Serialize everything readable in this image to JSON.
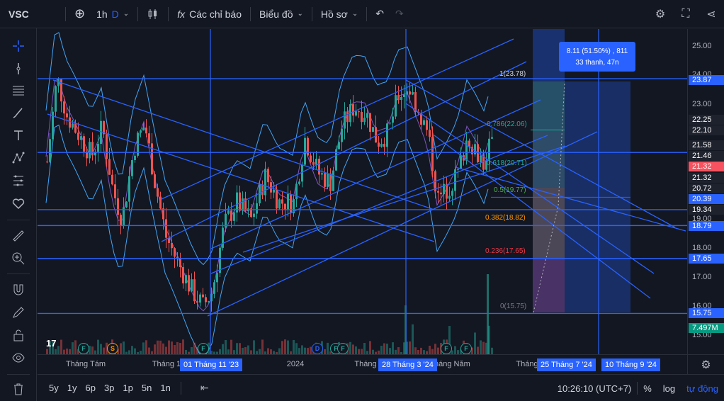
{
  "toolbar": {
    "symbol": "VSC",
    "interval": "1h",
    "interval_type": "D",
    "indicators_label": "Các chỉ báo",
    "chart_type_label": "Biểu đồ",
    "profile_label": "Hồ sơ"
  },
  "chart": {
    "measure_line1": "8.11 (51.50%) , 811",
    "measure_line2": "33 thanh, 47n",
    "fib_levels": [
      {
        "label": "1(23.78)",
        "color": "#787b86"
      },
      {
        "label": "0.786(22.06)",
        "color": "#26a69a"
      },
      {
        "label": "0.618(20.71)",
        "color": "#26a69a"
      },
      {
        "label": "0.5(19.77)",
        "color": "#4caf50"
      },
      {
        "label": "0.382(18.82)",
        "color": "#ff9800"
      },
      {
        "label": "0.236(17.65)",
        "color": "#f23645"
      },
      {
        "label": "0(15.75)",
        "color": "#787b86"
      }
    ],
    "event_badges": [
      "F",
      "S",
      "F",
      "D",
      "F",
      "F",
      "F",
      "F"
    ],
    "tv_logo": "17"
  },
  "price_axis": {
    "ticks": [
      "25.00",
      "24.00",
      "23.00",
      "19.00",
      "18.00",
      "17.00",
      "16.00",
      "15.00"
    ],
    "tags": [
      {
        "value": "23.87",
        "bg": "#2962ff"
      },
      {
        "value": "22.25",
        "bg": "#1e222d"
      },
      {
        "value": "22.10",
        "bg": "#1e222d"
      },
      {
        "value": "21.58",
        "bg": "#1e222d"
      },
      {
        "value": "21.46",
        "bg": "#1e222d"
      },
      {
        "value": "21.32",
        "bg": "#f7525f"
      },
      {
        "value": "21.32",
        "bg": "#1e222d"
      },
      {
        "value": "20.72",
        "bg": "#1e222d"
      },
      {
        "value": "20.39",
        "bg": "#2962ff"
      },
      {
        "value": "19.34",
        "bg": "#1e222d"
      },
      {
        "value": "18.79",
        "bg": "#2962ff"
      },
      {
        "value": "17.65",
        "bg": "#2962ff"
      },
      {
        "value": "15.75",
        "bg": "#2962ff"
      },
      {
        "value": "7.497M",
        "bg": "#089981"
      }
    ]
  },
  "time_axis": {
    "ticks": [
      "Tháng Tám",
      "Tháng 1",
      "2024",
      "Tháng",
      "Tháng Năm",
      "Tháng"
    ],
    "tags": [
      "01 Tháng 11 '23",
      "28 Tháng 3 '24",
      "25 Tháng 7 '24",
      "10 Tháng 9 '24"
    ]
  },
  "bottom": {
    "ranges": [
      "5y",
      "1y",
      "6p",
      "3p",
      "1p",
      "5n",
      "1n"
    ],
    "clock": "10:26:10 (UTC+7)",
    "percent": "%",
    "log": "log",
    "auto": "tự động"
  },
  "colors": {
    "up": "#26a69a",
    "down": "#ef5350",
    "accent": "#2962ff",
    "background": "#131722"
  }
}
